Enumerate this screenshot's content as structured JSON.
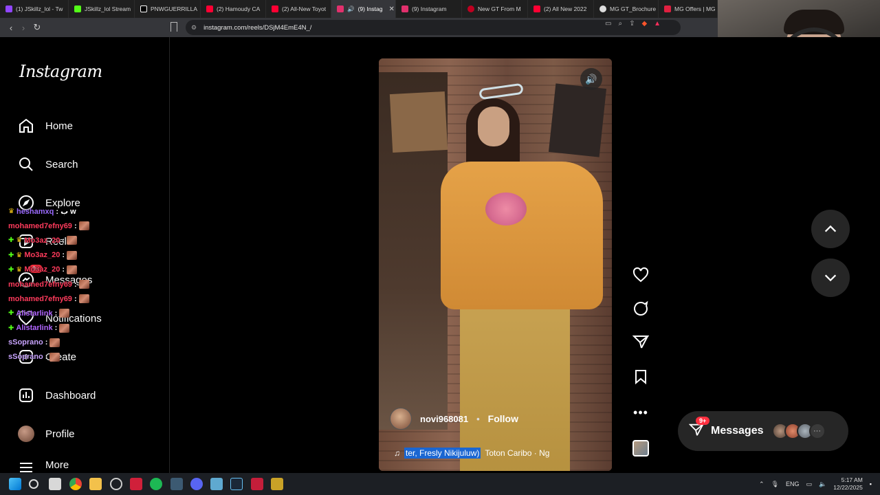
{
  "browser": {
    "tabs": [
      {
        "label": "(1) JSkillz_lol - Tw",
        "color": "#9146ff"
      },
      {
        "label": "JSkillz_lol Stream",
        "color": "#53fc18"
      },
      {
        "label": "PNWGUERRILLA",
        "color": "#ffffff"
      },
      {
        "label": "(2) Hamoudy CA",
        "color": "#ff0033"
      },
      {
        "label": "(2) All-New Toyot",
        "color": "#ff0033"
      },
      {
        "label": "(9) Instag",
        "color": "#e1306c",
        "active": true
      },
      {
        "label": "(9) Instagram",
        "color": "#e1306c"
      },
      {
        "label": "New GT From M",
        "color": "#c00020"
      },
      {
        "label": "(2) All New 2022",
        "color": "#ff0033"
      },
      {
        "label": "MG GT_Brochure",
        "color": "#dddddd"
      },
      {
        "label": "MG Offers | MG",
        "color": "#e02040"
      }
    ],
    "url": "instagram.com/reels/DSjM4EmE4N_/"
  },
  "sidebar": {
    "logo": "Instagram",
    "items": [
      {
        "label": "Home",
        "icon": "home-icon"
      },
      {
        "label": "Search",
        "icon": "search-icon"
      },
      {
        "label": "Explore",
        "icon": "explore-icon"
      },
      {
        "label": "Reels",
        "icon": "reels-icon"
      },
      {
        "label": "Messages",
        "icon": "messages-icon",
        "badge": "9+"
      },
      {
        "label": "Notifications",
        "icon": "heart-icon"
      },
      {
        "label": "Create",
        "icon": "create-icon"
      },
      {
        "label": "Dashboard",
        "icon": "dashboard-icon"
      },
      {
        "label": "Profile",
        "icon": "profile-avatar"
      },
      {
        "label": "More",
        "icon": "menu-icon"
      }
    ]
  },
  "chat": [
    {
      "user": "heshamxq",
      "msg": "ب w",
      "color": "#9b6bff",
      "badge": "crown"
    },
    {
      "user": "mohamed7efny69",
      "msg": "",
      "color": "#ff3b5c",
      "emote": true
    },
    {
      "user": "Mo3az_20",
      "msg": "",
      "color": "#ff3b5c",
      "badge": "plus-crown",
      "emote": true
    },
    {
      "user": "Mo3az_20",
      "msg": "",
      "color": "#ff3b5c",
      "badge": "plus-crown",
      "emote": true
    },
    {
      "user": "Mo3az_20",
      "msg": "",
      "color": "#ff3b5c",
      "badge": "plus-crown",
      "emote": true
    },
    {
      "user": "mohamed7efny69",
      "msg": "",
      "color": "#ff3b5c",
      "emote": true
    },
    {
      "user": "mohamed7efny69",
      "msg": "",
      "color": "#ff3b5c",
      "emote": true
    },
    {
      "user": "Alistarlink",
      "msg": "",
      "color": "#b266ff",
      "badge": "plus",
      "emote": true
    },
    {
      "user": "Alistarlink",
      "msg": "",
      "color": "#b266ff",
      "badge": "plus",
      "emote": true
    },
    {
      "user": "sSoprano",
      "msg": "",
      "color": "#c9a4ff",
      "emote": true
    },
    {
      "user": "sSoprano",
      "msg": "",
      "color": "#c9a4ff",
      "emote": true
    }
  ],
  "reel": {
    "username": "novi968081",
    "separator": "•",
    "follow": "Follow",
    "audio_highlight": "ter, Fresly Nikijuluw)",
    "audio_rest": "Toton Caribo · Ng"
  },
  "messages_pill": {
    "label": "Messages",
    "badge": "9+",
    "more": "···"
  },
  "taskbar": {
    "lang": "ENG",
    "time": "5:17 AM",
    "date": "12/22/2025"
  }
}
